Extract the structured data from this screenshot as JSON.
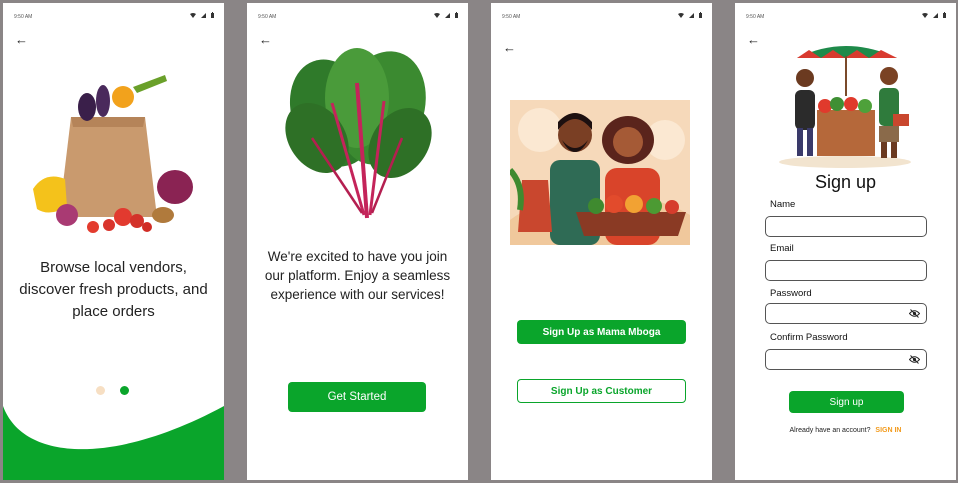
{
  "status_bar": {
    "time": "9:50 AM"
  },
  "screen1": {
    "headline": "Browse local vendors, discover fresh products, and place orders",
    "dots": [
      "inactive",
      "active"
    ],
    "colors": {
      "accent": "#0aa52b",
      "dot_inactive": "#f7dfc3"
    }
  },
  "screen2": {
    "headline": "We're excited to have you join our platform. Enjoy a seamless experience with our services!",
    "button": "Get Started"
  },
  "screen3": {
    "button_primary": "Sign Up as Mama Mboga",
    "button_secondary": "Sign  Up as Customer"
  },
  "screen4": {
    "title": "Sign up",
    "fields": [
      {
        "label": "Name",
        "value": ""
      },
      {
        "label": "Email",
        "value": ""
      },
      {
        "label": "Password",
        "value": ""
      },
      {
        "label": "Confirm Password",
        "value": ""
      }
    ],
    "button": "Sign  up",
    "signin_prompt": "Already have an account?",
    "signin_link": "SIGN IN",
    "colors": {
      "link": "#f29a1c"
    }
  },
  "icons": {
    "back": "arrow-left-icon",
    "wifi": "wifi-icon",
    "signal": "signal-icon",
    "battery": "battery-icon",
    "eye": "eye-off-icon"
  }
}
